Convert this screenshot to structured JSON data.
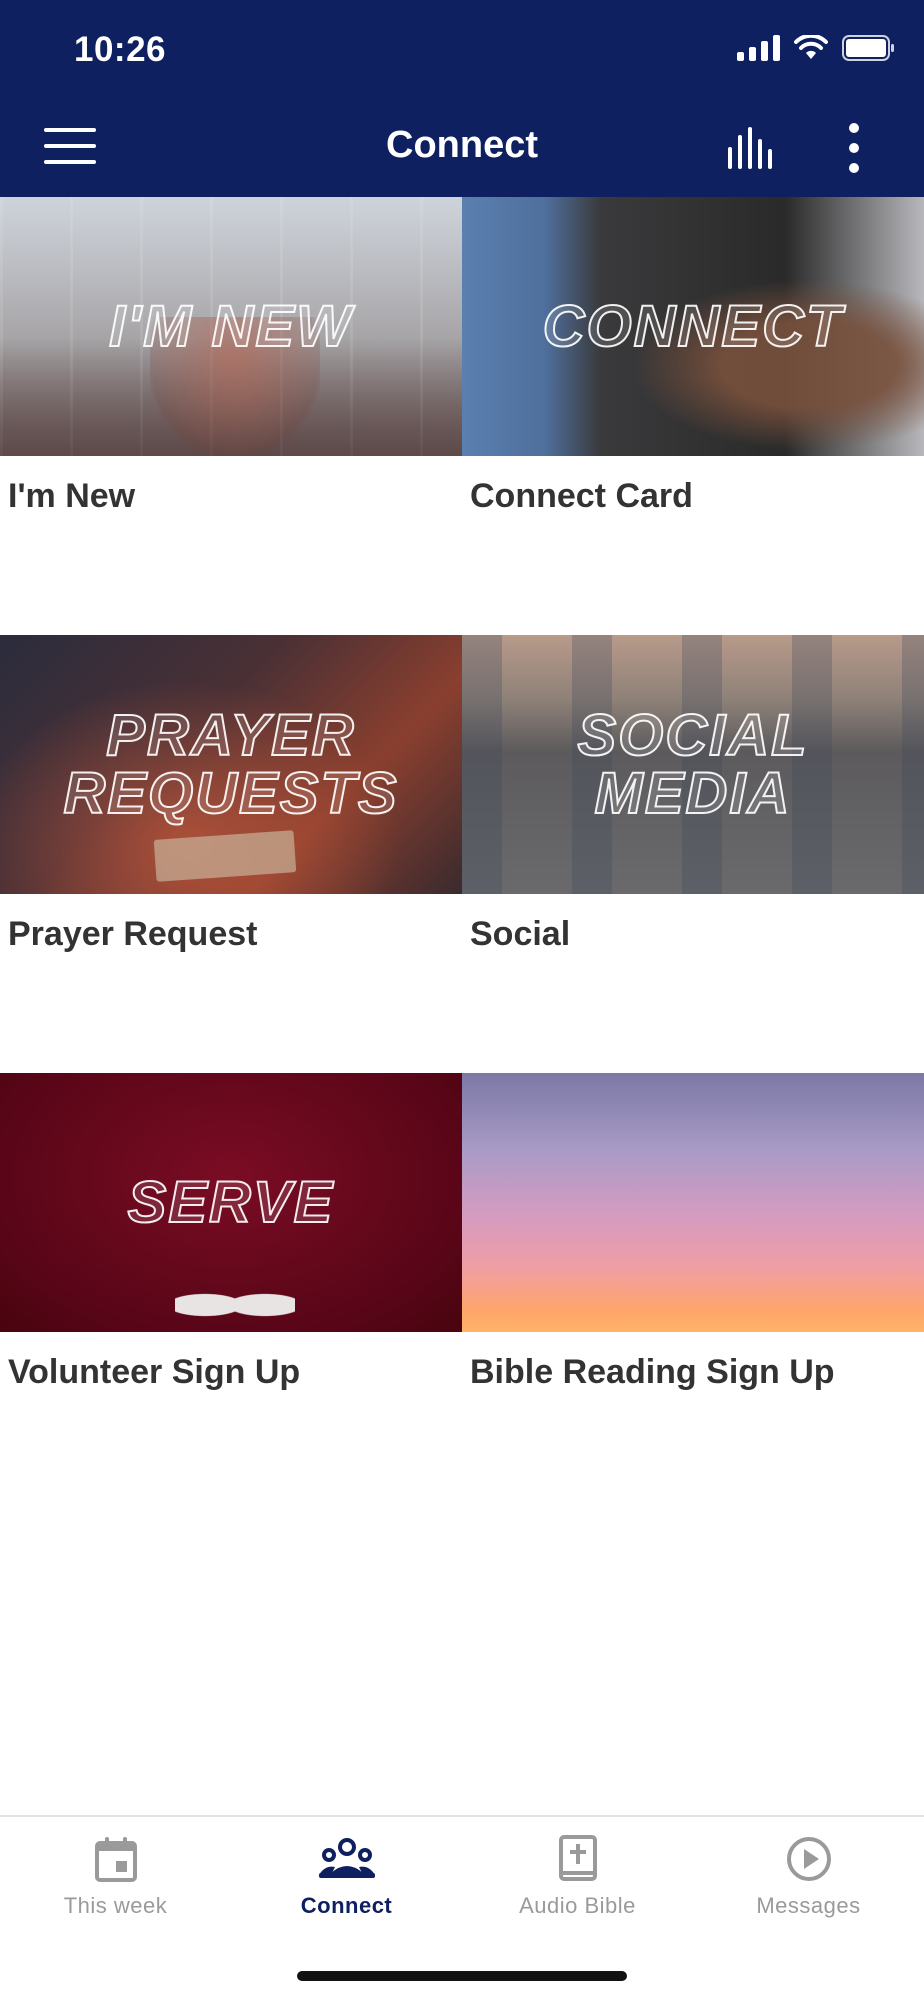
{
  "status_bar": {
    "time": "10:26"
  },
  "header": {
    "title": "Connect",
    "background": "#0e2060"
  },
  "tiles": [
    {
      "overlay": [
        "I'M NEW"
      ],
      "label": "I'm New"
    },
    {
      "overlay": [
        "CONNECT"
      ],
      "label": "Connect Card"
    },
    {
      "overlay": [
        "PRAYER",
        "REQUESTS"
      ],
      "label": "Prayer Request"
    },
    {
      "overlay": [
        "SOCIAL",
        "MEDIA"
      ],
      "label": "Social"
    },
    {
      "overlay": [
        "SERVE"
      ],
      "label": "Volunteer Sign Up"
    },
    {
      "overlay": [],
      "label": "Bible Reading Sign Up"
    }
  ],
  "bottom_nav": {
    "items": [
      {
        "label": "This week",
        "icon": "calendar-icon",
        "active": false
      },
      {
        "label": "Connect",
        "icon": "people-icon",
        "active": true
      },
      {
        "label": "Audio Bible",
        "icon": "bible-icon",
        "active": false
      },
      {
        "label": "Messages",
        "icon": "play-circle-icon",
        "active": false
      }
    ],
    "active_color": "#0e2060",
    "inactive_color": "#9a9a9a"
  }
}
